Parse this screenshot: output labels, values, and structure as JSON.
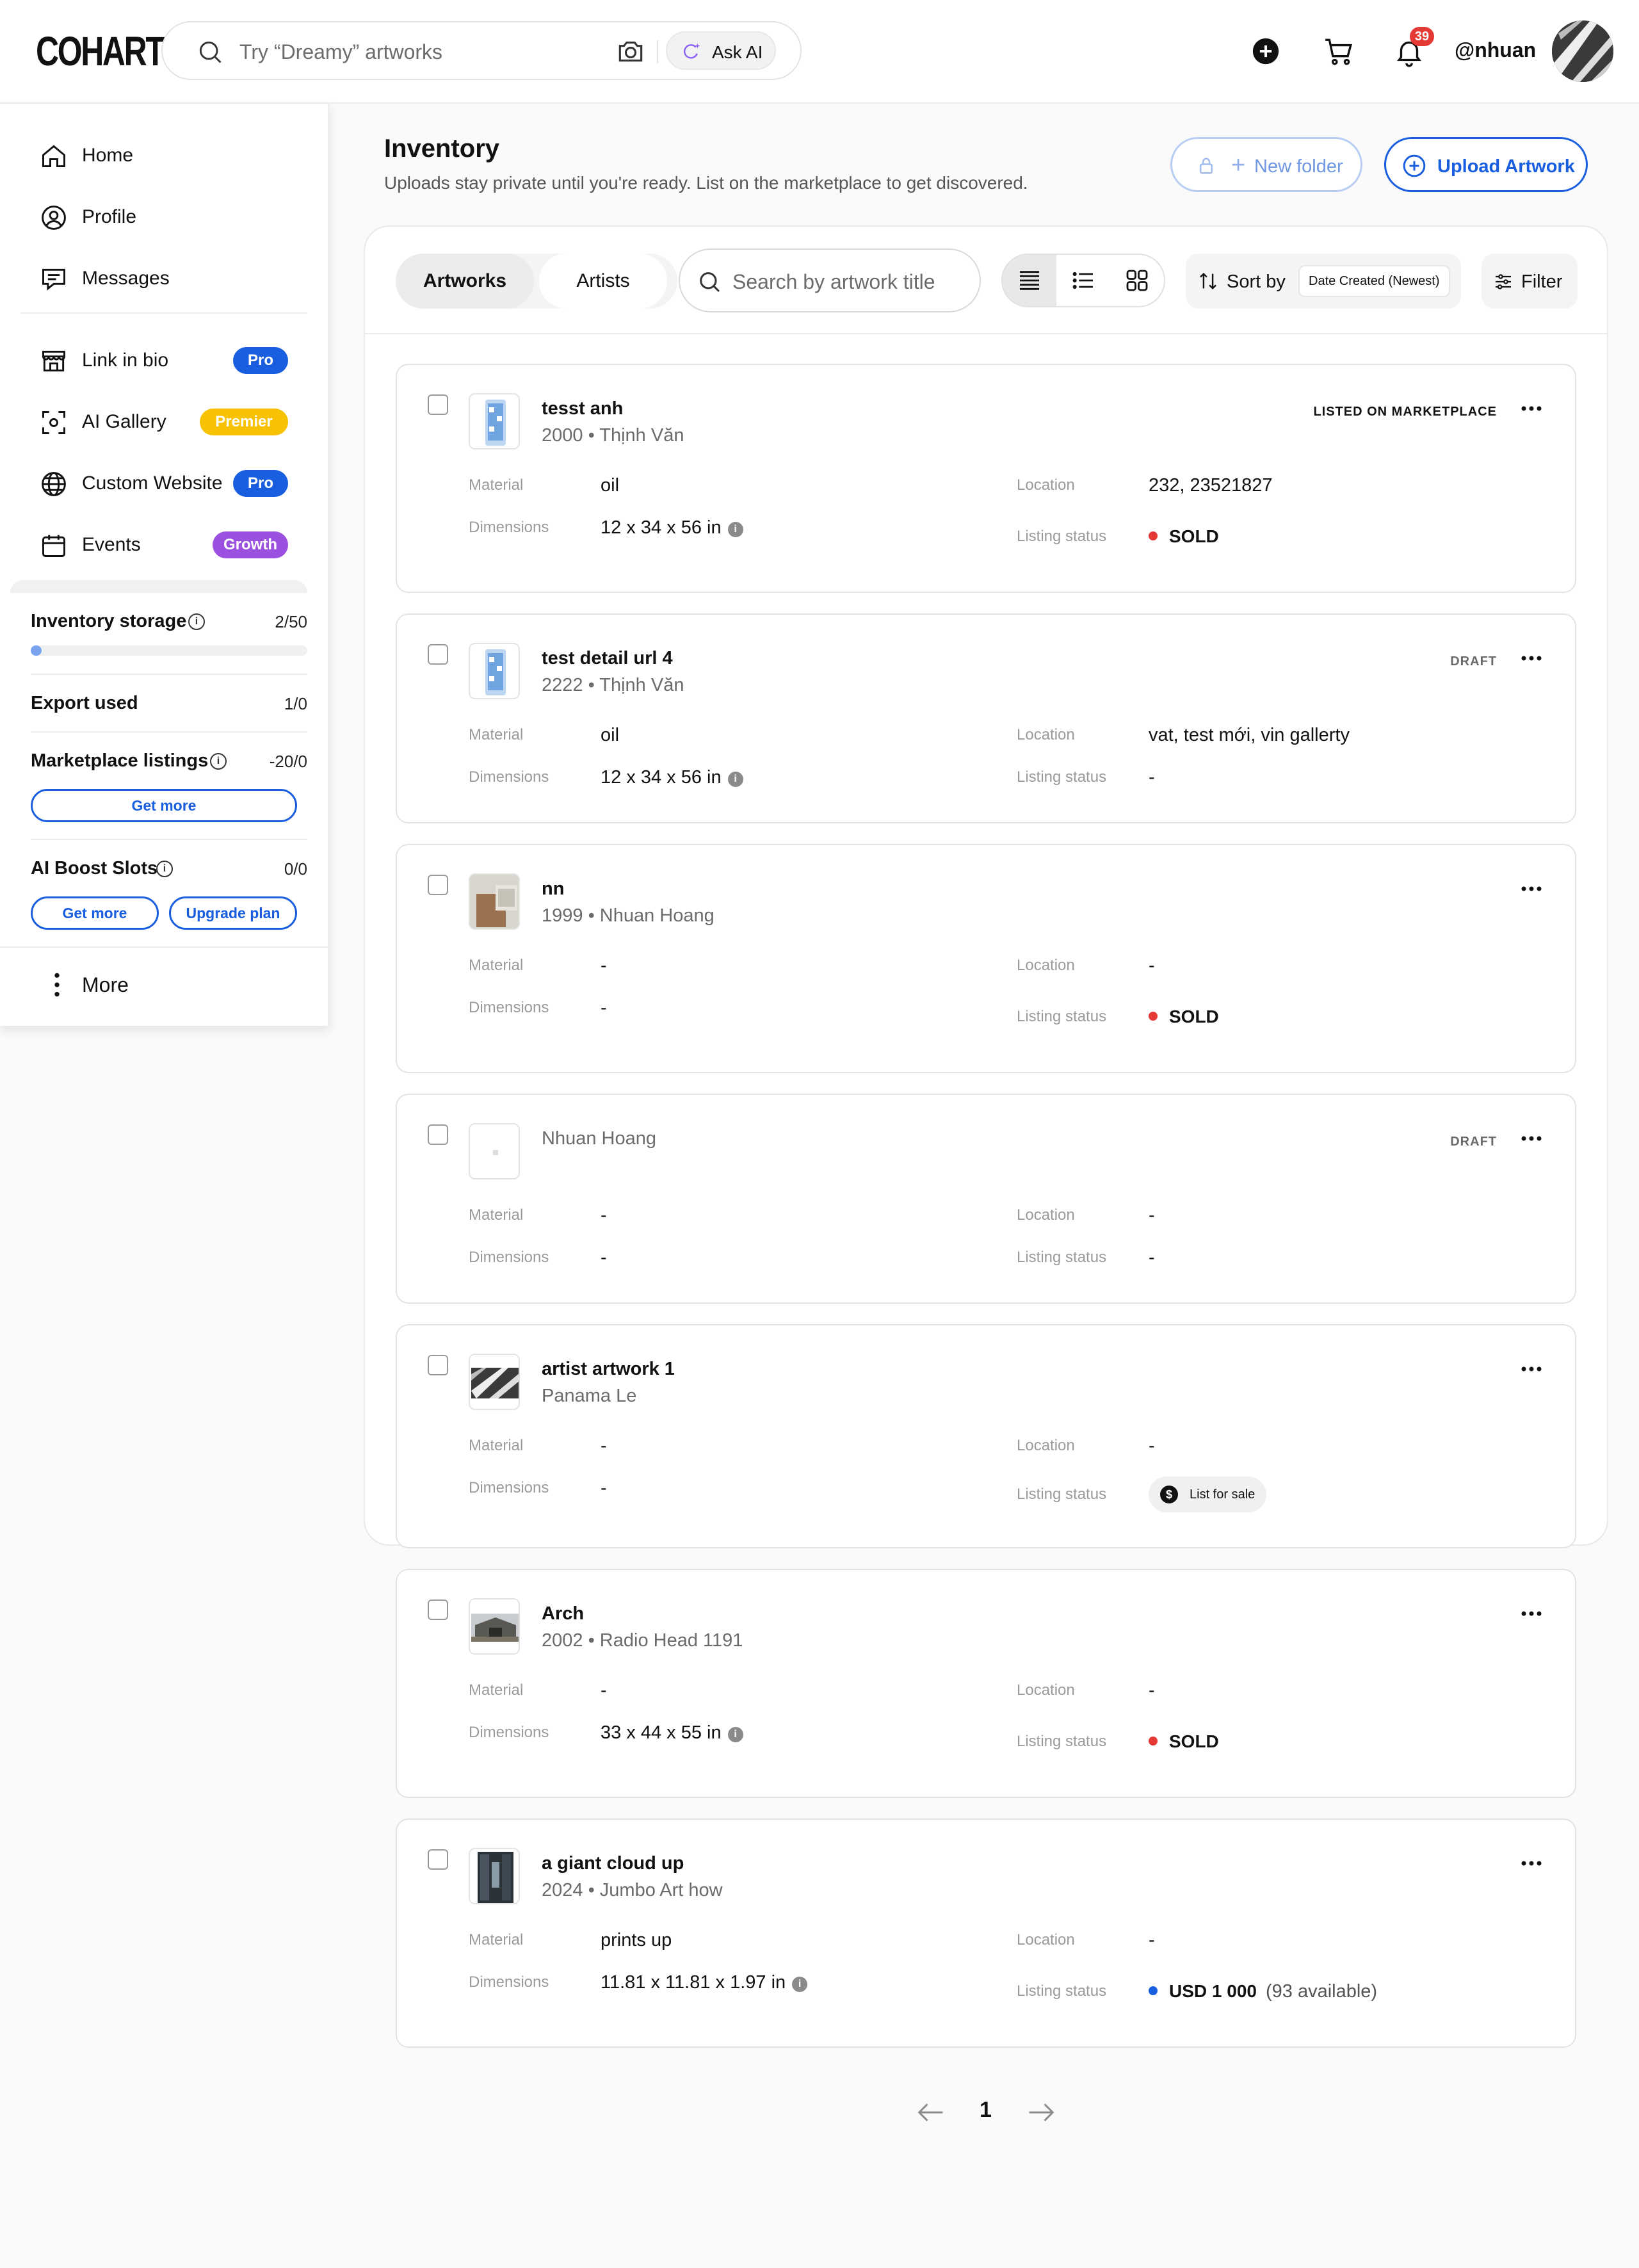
{
  "topbar": {
    "logo": "COHART",
    "search_placeholder": "Try “Dreamy” artworks",
    "ask_ai_label": "Ask AI",
    "notification_count": "39",
    "username": "@nhuan"
  },
  "sidebar": {
    "nav": [
      {
        "label": "Home",
        "icon": "home-icon"
      },
      {
        "label": "Profile",
        "icon": "profile-icon"
      },
      {
        "label": "Messages",
        "icon": "messages-icon"
      }
    ],
    "features": [
      {
        "label": "Link in bio",
        "icon": "store-icon",
        "badge": "Pro",
        "badge_color": "#1a5ee0"
      },
      {
        "label": "AI Gallery",
        "icon": "ai-scan-icon",
        "badge": "Premier",
        "badge_color": "#f7c203"
      },
      {
        "label": "Custom Website",
        "icon": "globe-icon",
        "badge": "Pro",
        "badge_color": "#1a5ee0"
      },
      {
        "label": "Events",
        "icon": "calendar-icon",
        "badge": "Growth",
        "badge_color": "#9b51e0"
      }
    ],
    "usage": {
      "inventory_storage_label": "Inventory storage",
      "inventory_storage_value": "2/50",
      "inventory_storage_fraction": 0.04,
      "export_used_label": "Export used",
      "export_used_value": "1/0",
      "marketplace_label": "Marketplace listings",
      "marketplace_value": "-20/0",
      "marketplace_get_more": "Get more",
      "ai_boost_label": "AI Boost Slots",
      "ai_boost_value": "0/0",
      "ai_boost_get_more": "Get more",
      "ai_boost_upgrade": "Upgrade plan"
    },
    "more_label": "More"
  },
  "header": {
    "title": "Inventory",
    "subtitle": "Uploads stay private until you're ready. List on the marketplace to get discovered.",
    "new_folder_label": "New folder",
    "upload_label": "Upload Artwork"
  },
  "toolbar": {
    "tab_artworks": "Artworks",
    "tab_artists": "Artists",
    "search_placeholder": "Search by artwork title",
    "sort_label": "Sort by",
    "sort_value": "Date Created (Newest)",
    "filter_label": "Filter"
  },
  "labels": {
    "material": "Material",
    "dimensions": "Dimensions",
    "location": "Location",
    "listing_status": "Listing status"
  },
  "artworks": [
    {
      "title": "tesst anh",
      "year": "2000",
      "artist": "Thịnh Văn",
      "status_tag": "LISTED ON MARKETPLACE",
      "material": "oil",
      "dimensions": "12 x 34 x 56 in",
      "location": "232, 23521827",
      "listing_status": "SOLD"
    },
    {
      "title": "test detail url 4",
      "year": "2222",
      "artist": "Thịnh Văn",
      "status_tag": "DRAFT",
      "material": "oil",
      "dimensions": "12 x 34 x 56 in",
      "location": "vat, test mới, vin gallerty",
      "listing_status": "-"
    },
    {
      "title": "nn",
      "year": "1999",
      "artist": "Nhuan Hoang",
      "status_tag": "",
      "material": "-",
      "dimensions": "-",
      "location": "-",
      "listing_status": "SOLD"
    },
    {
      "title": "",
      "year": "",
      "artist": "Nhuan Hoang",
      "status_tag": "DRAFT",
      "material": "-",
      "dimensions": "-",
      "location": "-",
      "listing_status": "-"
    },
    {
      "title": "artist artwork 1",
      "year": "",
      "artist": "Panama Le",
      "status_tag": "",
      "material": "-",
      "dimensions": "-",
      "location": "-",
      "listing_status": "List for sale"
    },
    {
      "title": "Arch",
      "year": "2002",
      "artist": "Radio Head 1191",
      "status_tag": "",
      "material": "-",
      "dimensions": "33 x 44 x 55 in",
      "location": "-",
      "listing_status": "SOLD"
    },
    {
      "title": "a giant cloud up",
      "year": "2024",
      "artist": "Jumbo Art how",
      "status_tag": "",
      "material": "prints up",
      "dimensions": "11.81 x 11.81 x 1.97 in",
      "location": "-",
      "listing_status": "USD 1 000",
      "availability": "(93 available)"
    }
  ],
  "pagination": {
    "current_page": "1"
  }
}
